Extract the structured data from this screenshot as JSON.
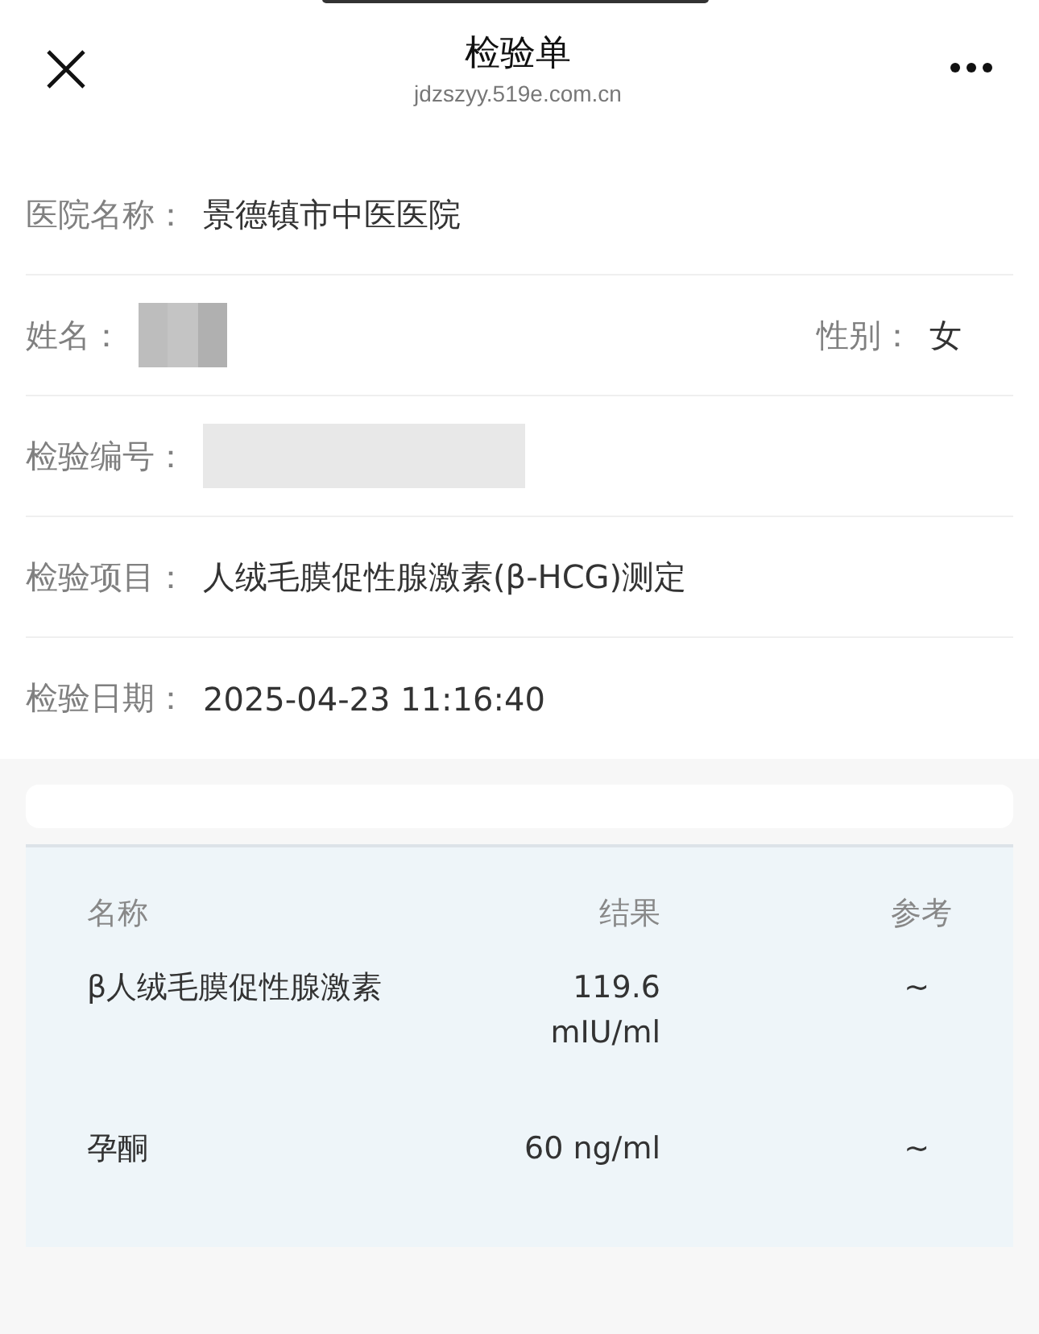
{
  "header": {
    "title": "检验单",
    "url": "jdzszyy.519e.com.cn"
  },
  "fields": [
    {
      "kind": "text",
      "label": "医院名称：",
      "value": "景德镇市中医医院"
    },
    {
      "kind": "redacted",
      "label": "姓名：",
      "side": {
        "label": "性别：",
        "value": "女"
      }
    },
    {
      "kind": "redacted",
      "label": "检验编号："
    },
    {
      "kind": "text",
      "label": "检验项目：",
      "value": "人绒毛膜促性腺激素(β-HCG)测定"
    },
    {
      "kind": "text",
      "label": "检验日期：",
      "value": "2025-04-23 11:16:40"
    }
  ],
  "table": {
    "columns": [
      "名称",
      "结果",
      "参考"
    ],
    "rows": [
      {
        "name": "β人绒毛膜促性腺激素",
        "result": "119.6 mIU/ml",
        "reference": "~"
      },
      {
        "name": "孕酮",
        "result": "60 ng/ml",
        "reference": "~"
      }
    ]
  }
}
